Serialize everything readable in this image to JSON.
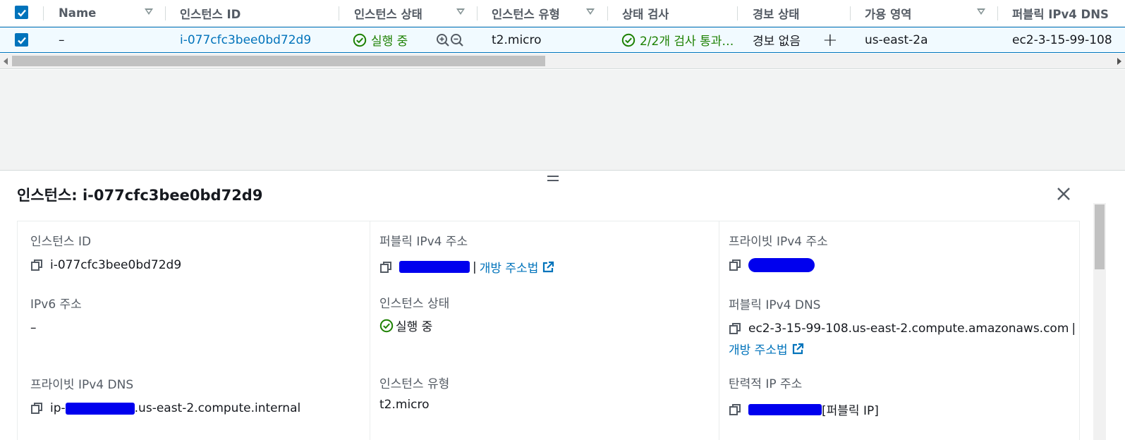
{
  "table": {
    "columns": [
      {
        "label": "Name"
      },
      {
        "label": "인스턴스 ID"
      },
      {
        "label": "인스턴스 상태"
      },
      {
        "label": "인스턴스 유형"
      },
      {
        "label": "상태 검사"
      },
      {
        "label": "경보 상태"
      },
      {
        "label": "가용 영역"
      },
      {
        "label": "퍼블릭 IPv4 DNS"
      }
    ],
    "row": {
      "name": "–",
      "instance_id": "i-077cfc3bee0bd72d9",
      "state": "실행 중",
      "type": "t2.micro",
      "status_check": "2/2개 검사 통과…",
      "alarm": "경보 없음",
      "add_alarm": "+",
      "az": "us-east-2a",
      "dns": "ec2-3-15-99-108"
    }
  },
  "panel": {
    "title": "인스턴스: i-077cfc3bee0bd72d9",
    "fields": {
      "instance_id_label": "인스턴스 ID",
      "instance_id_value": "i-077cfc3bee0bd72d9",
      "public_ipv4_label": "퍼블릭 IPv4 주소",
      "open_address": "개방 주소법",
      "private_ipv4_label": "프라이빗 IPv4 주소",
      "ipv6_label": "IPv6 주소",
      "ipv6_value": "–",
      "state_label": "인스턴스 상태",
      "state_value": "실행 중",
      "public_dns_label": "퍼블릭 IPv4 DNS",
      "public_dns_value": "ec2-3-15-99-108.us-east-2.compute.amazonaws.com",
      "pipe": "|",
      "private_dns_label": "프라이빗 IPv4 DNS",
      "private_dns_prefix": "ip-",
      "private_dns_suffix": ".us-east-2.compute.internal",
      "type_label": "인스턴스 유형",
      "type_value": "t2.micro",
      "elastic_ip_label": "탄력적 IP 주소",
      "elastic_ip_suffix": "[퍼블릭 IP]"
    }
  },
  "colors": {
    "link": "#0073bb",
    "success": "#1d8102",
    "redaction": "#0000ee"
  }
}
